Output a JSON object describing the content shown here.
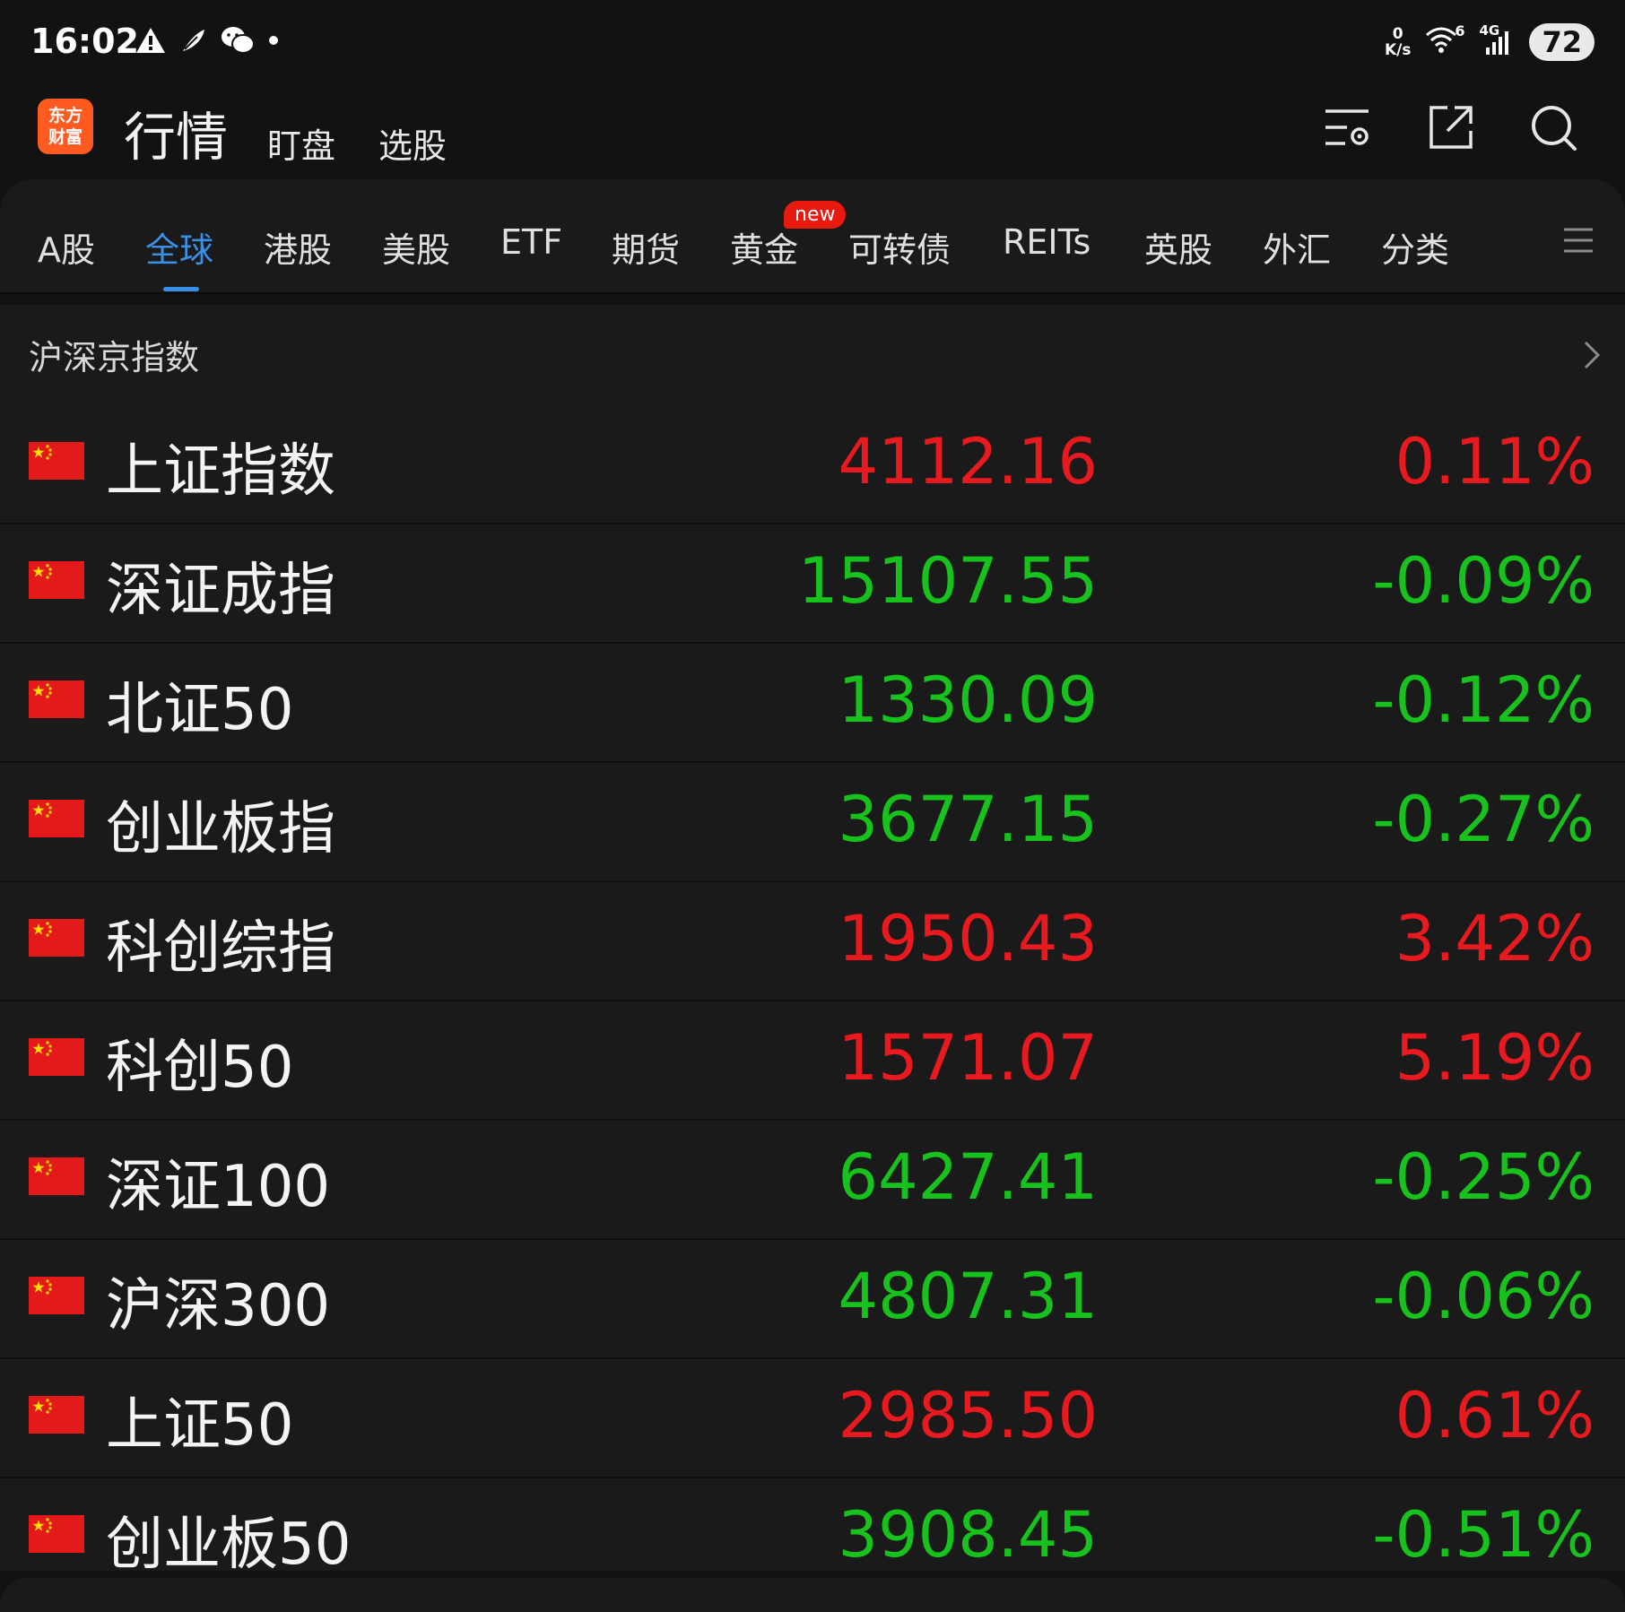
{
  "status_bar": {
    "time": "16:02",
    "speed_value": "0",
    "speed_unit": "K/s",
    "wifi_label": "6",
    "network": "4G",
    "battery": "72"
  },
  "header": {
    "logo_line1": "东方",
    "logo_line2": "财富",
    "title": "行情",
    "links": [
      "盯盘",
      "选股"
    ]
  },
  "tabs": [
    "A股",
    "全球",
    "港股",
    "美股",
    "ETF",
    "期货",
    "黄金",
    "可转债",
    "REITs",
    "英股",
    "外汇",
    "分类"
  ],
  "active_tab": "全球",
  "new_badge": "new",
  "section": {
    "title": "沪深京指数",
    "rows": [
      {
        "name": "上证指数",
        "price": "4112.16",
        "change": "0.11%",
        "trend": "up"
      },
      {
        "name": "深证成指",
        "price": "15107.55",
        "change": "-0.09%",
        "trend": "down"
      },
      {
        "name": "北证50",
        "price": "1330.09",
        "change": "-0.12%",
        "trend": "down"
      },
      {
        "name": "创业板指",
        "price": "3677.15",
        "change": "-0.27%",
        "trend": "down"
      },
      {
        "name": "科创综指",
        "price": "1950.43",
        "change": "3.42%",
        "trend": "up"
      },
      {
        "name": "科创50",
        "price": "1571.07",
        "change": "5.19%",
        "trend": "up"
      },
      {
        "name": "深证100",
        "price": "6427.41",
        "change": "-0.25%",
        "trend": "down"
      },
      {
        "name": "沪深300",
        "price": "4807.31",
        "change": "-0.06%",
        "trend": "down"
      },
      {
        "name": "上证50",
        "price": "2985.50",
        "change": "0.61%",
        "trend": "up"
      },
      {
        "name": "创业板50",
        "price": "3908.45",
        "change": "-0.51%",
        "trend": "down"
      }
    ]
  },
  "colors": {
    "up": "#e8191f",
    "down": "#18c21d",
    "accent": "#3a8ee6",
    "logo": "#ff5a1f",
    "background": "#121212",
    "panel": "#1a1a1a"
  }
}
